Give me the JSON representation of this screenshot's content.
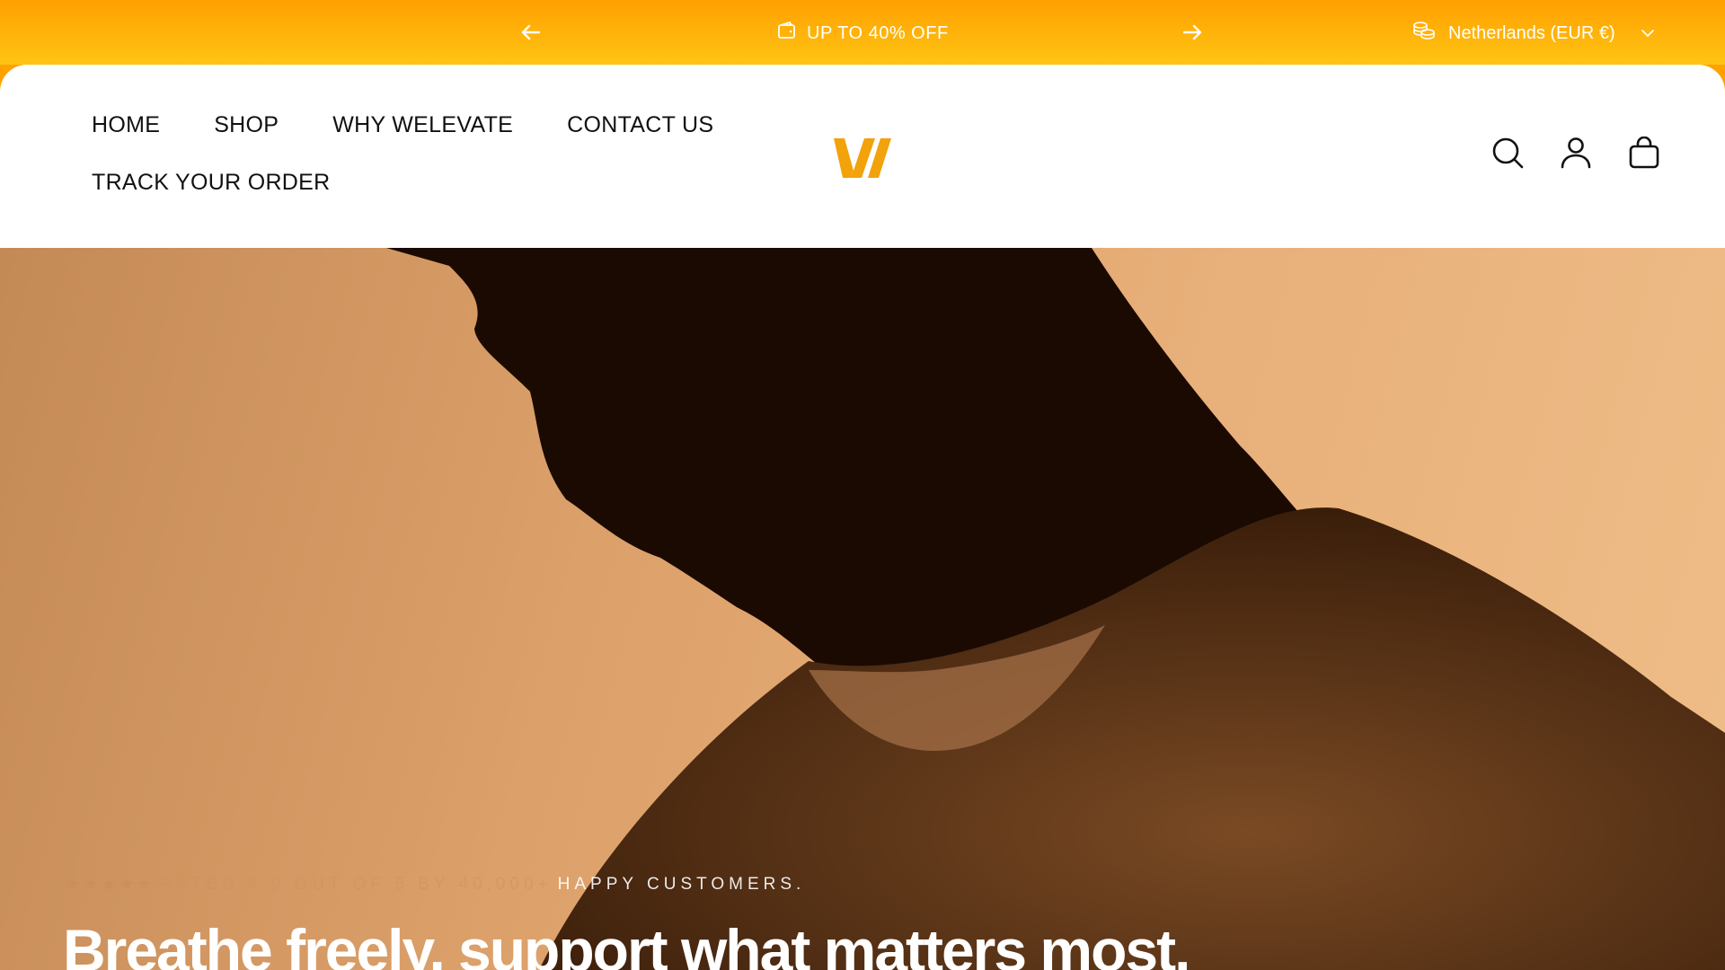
{
  "announcement": {
    "promo_text": "UP TO 40% OFF",
    "locale_label": "Netherlands (EUR €)"
  },
  "nav": {
    "items": [
      {
        "label": "HOME"
      },
      {
        "label": "SHOP"
      },
      {
        "label": "WHY WELEVATE"
      },
      {
        "label": "CONTACT US"
      },
      {
        "label": "TRACK YOUR ORDER"
      }
    ]
  },
  "hero": {
    "rating_prefix": "RATED 4.9 OUT OF 5 BY 40,000+",
    "rating_suffix": "HAPPY CUSTOMERS.",
    "rating_stars": "★★★★★",
    "headline": "Breathe freely, support what matters most."
  },
  "colors": {
    "accent": "#ffa200",
    "logo": "#f2a20a",
    "header_bg": "#ffffff",
    "text": "#111111"
  },
  "icons": [
    "arrow-left-icon",
    "arrow-right-icon",
    "wallet-icon",
    "coins-icon",
    "chevron-down-icon",
    "search-icon",
    "account-icon",
    "bag-icon"
  ]
}
